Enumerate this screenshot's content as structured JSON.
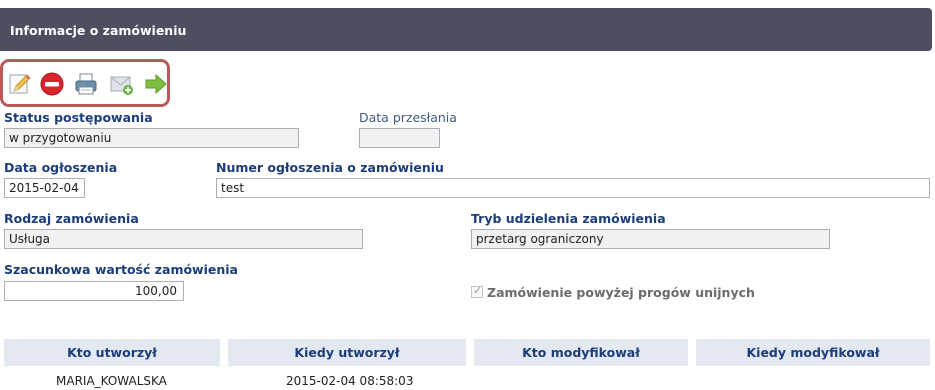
{
  "header": {
    "title": "Informacje o zamówieniu"
  },
  "toolbar": {
    "icons": [
      "edit-icon",
      "delete-icon",
      "print-icon",
      "send-email-icon",
      "forward-arrow-icon"
    ],
    "highlight_color": "#b9595b"
  },
  "form": {
    "status": {
      "label": "Status postępowania",
      "value": "w przygotowaniu"
    },
    "data_przeslania": {
      "label": "Data przesłania",
      "value": ""
    },
    "data_ogloszenia": {
      "label": "Data ogłoszenia",
      "value": "2015-02-04"
    },
    "numer_ogloszenia": {
      "label": "Numer ogłoszenia o zamówieniu",
      "value": "test"
    },
    "rodzaj": {
      "label": "Rodzaj zamówienia",
      "value": "Usługa"
    },
    "tryb": {
      "label": "Tryb udzielenia zamówienia",
      "value": "przetarg ograniczony"
    },
    "wartosc": {
      "label": "Szacunkowa wartość zamówienia",
      "value": "100,00"
    },
    "powyzej_progow": {
      "label": "Zamówienie powyżej progów unijnych",
      "checked": true
    }
  },
  "table": {
    "headers": [
      "Kto utworzył",
      "Kiedy utworzył",
      "Kto modyfikował",
      "Kiedy modyfikował"
    ],
    "rows": [
      [
        "MARIA_KOWALSKA",
        "2015-02-04 08:58:03",
        "",
        ""
      ]
    ]
  },
  "colors": {
    "header_bg": "#4d4f60",
    "label": "#1c3d7a",
    "table_header_bg": "#e4e8f0"
  }
}
